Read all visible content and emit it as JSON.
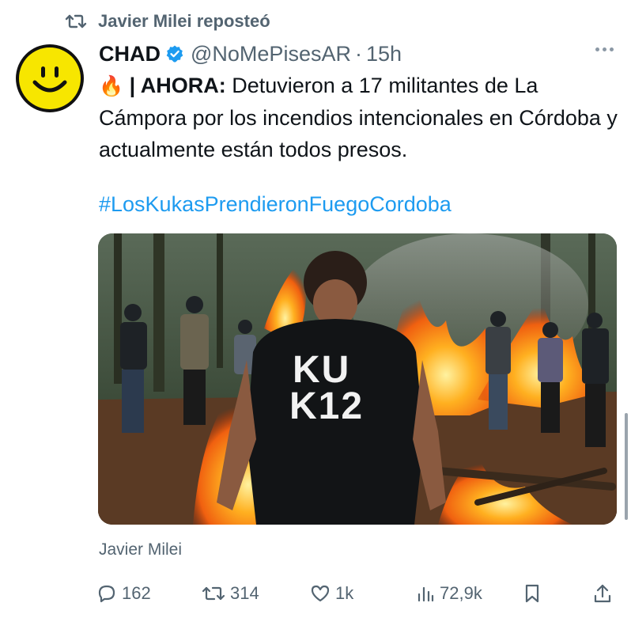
{
  "repost": {
    "text": "Javier Milei reposteó",
    "icon": "repost-icon"
  },
  "author": {
    "avatar_icon": "smiley-avatar",
    "name": "CHAD",
    "handle": "@NoMePisesAR",
    "separator": "·",
    "time": "15h",
    "verified_icon": "verified-badge-icon",
    "verified_color": "#1d9bf0"
  },
  "tweet": {
    "emoji": "🔥",
    "prefix": "| AHORA:",
    "body": " Detuvieron a 17 militantes de La Cámpora por los incendios intencionales en Córdoba y actualmente están todos presos.",
    "hashtag": "#LosKukasPrendieronFuegoCordoba",
    "hashtag_color": "#1d9bf0"
  },
  "media": {
    "shirt_line1": "KU",
    "shirt_line2": "K12"
  },
  "caption": "Javier Milei",
  "actions": {
    "replies": "162",
    "reposts": "314",
    "likes": "1k",
    "views": "72,9k"
  },
  "colors": {
    "secondary_text": "#536471",
    "accent": "#1d9bf0"
  }
}
